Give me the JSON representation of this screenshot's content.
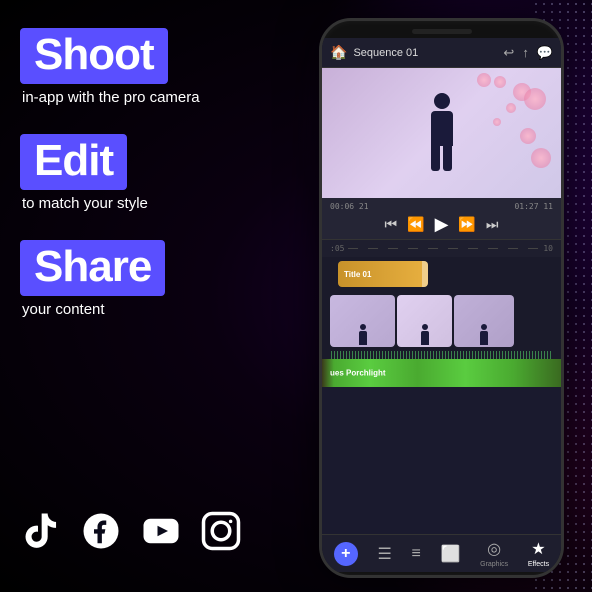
{
  "background": {
    "color": "#0a0a1a"
  },
  "features": [
    {
      "label": "Shoot",
      "sublabel": "in-app with the pro camera"
    },
    {
      "label": "Edit",
      "sublabel": "to match your style"
    },
    {
      "label": "Share",
      "sublabel": "your content"
    }
  ],
  "social_icons": [
    "tiktok",
    "facebook",
    "youtube",
    "instagram"
  ],
  "phone": {
    "app": {
      "header": {
        "home_icon": "🏠",
        "title": "Sequence 01",
        "back_icon": "↩",
        "share_icon": "↑",
        "chat_icon": "💬"
      },
      "timecodes": {
        "current": "00:06 21",
        "total": "01:27 11"
      },
      "ruler_labels": [
        ":05",
        "10"
      ],
      "title_clip_label": "Title 01",
      "audio_track_label": "ues Porchlight",
      "toolbar": {
        "add_label": "+",
        "items": [
          {
            "icon": "☰",
            "label": ""
          },
          {
            "icon": "≡",
            "label": ""
          },
          {
            "icon": "⬜",
            "label": ""
          },
          {
            "icon": "◎",
            "label": "Graphics",
            "active": false
          },
          {
            "icon": "★",
            "label": "Effects",
            "active": true
          }
        ]
      }
    }
  }
}
